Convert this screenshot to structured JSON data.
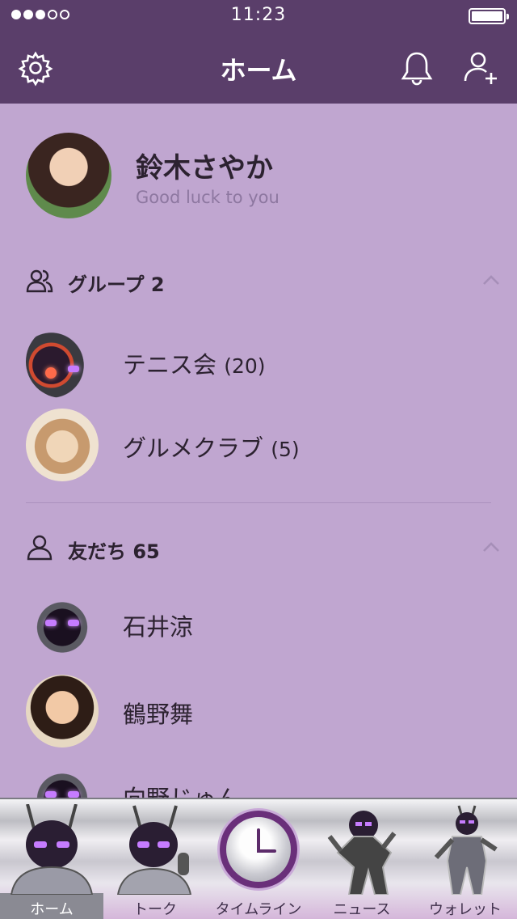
{
  "status_bar": {
    "time": "11:23",
    "signal_filled": 3,
    "signal_total": 5,
    "battery_level": 1.0
  },
  "nav": {
    "title": "ホーム",
    "left_icon": "gear-icon",
    "right_icons": [
      "bell-icon",
      "add-friend-icon"
    ]
  },
  "profile": {
    "name": "鈴木さやか",
    "status_message": "Good luck to you"
  },
  "groups": {
    "header": "グループ 2",
    "items": [
      {
        "name": "テニス会",
        "count": "(20)"
      },
      {
        "name": "グルメクラブ",
        "count": "(5)"
      }
    ]
  },
  "friends": {
    "header": "友だち 65",
    "items": [
      {
        "name": "石井涼"
      },
      {
        "name": "鶴野舞"
      },
      {
        "name": "向野じゅん"
      }
    ]
  },
  "tabbar": {
    "tabs": [
      {
        "label": "ホーム",
        "active": true
      },
      {
        "label": "トーク",
        "active": false
      },
      {
        "label": "タイムライン",
        "active": false
      },
      {
        "label": "ニュース",
        "active": false
      },
      {
        "label": "ウォレット",
        "active": false
      }
    ]
  },
  "colors": {
    "nav_bg": "#5a3e6a",
    "content_bg": "#c0a6d0",
    "text_primary": "#2c2230",
    "status_text": "#8d77a0"
  }
}
